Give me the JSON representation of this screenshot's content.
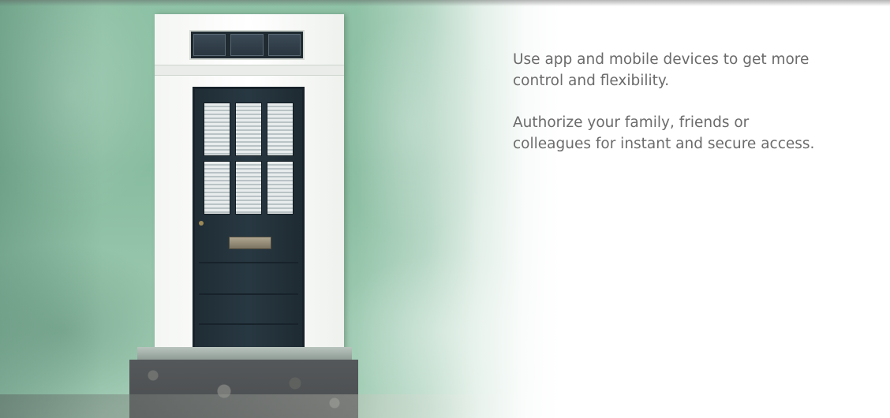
{
  "hero": {
    "image_alt": "green-wall-front-door"
  },
  "content": {
    "paragraph_1": "Use app and mobile devices to get more control and flexibility.",
    "paragraph_2": "Authorize your family, friends or colleagues for instant and secure access."
  },
  "colors": {
    "text": "#6b6b6b",
    "wall": "#8fc2a6",
    "door": "#243239",
    "background": "#ffffff"
  }
}
